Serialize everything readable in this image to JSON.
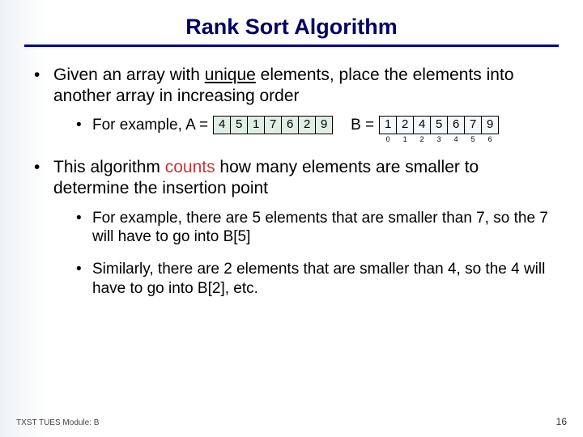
{
  "title": "Rank Sort Algorithm",
  "bullets": {
    "intro_pre": "Given an array with ",
    "intro_underlined": "unique",
    "intro_post": " elements, place the elements into another array in increasing order",
    "example_label": "For example, A = ",
    "b_label": "B = ",
    "algo_pre": "This algorithm ",
    "algo_counts": "counts",
    "algo_post": " how many elements are smaller to determine the insertion point",
    "ex1": "For example, there are 5 elements that are smaller than 7, so the 7 will have to go into B[5]",
    "ex2": "Similarly, there are 2 elements that are smaller than 4, so the 4 will have to go into B[2], etc."
  },
  "arrays": {
    "A": [
      "4",
      "5",
      "1",
      "7",
      "6",
      "2",
      "9"
    ],
    "B": [
      "1",
      "2",
      "4",
      "5",
      "6",
      "7",
      "9"
    ],
    "B_idx": [
      "0",
      "1",
      "2",
      "3",
      "4",
      "5",
      "6"
    ]
  },
  "footer": "TXST TUES Module: B",
  "page": "16"
}
